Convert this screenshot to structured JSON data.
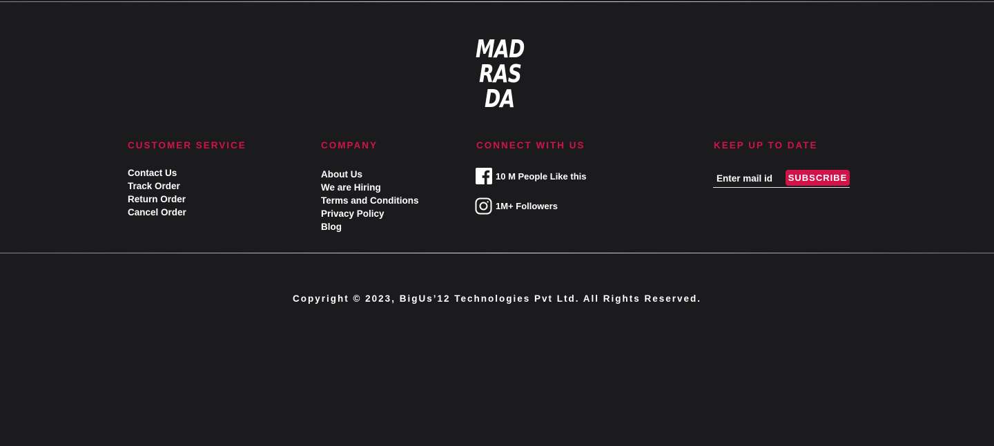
{
  "logo": {
    "lines": [
      "MAD",
      "RAS",
      "DA"
    ]
  },
  "columns": {
    "customer_service": {
      "title": "CUSTOMER SERVICE",
      "links": [
        "Contact Us",
        "Track Order",
        "Return Order",
        "Cancel Order"
      ]
    },
    "company": {
      "title": "COMPANY",
      "links": [
        "About Us",
        "We are Hiring",
        "Terms and Conditions",
        "Privacy Policy",
        "Blog"
      ]
    },
    "connect": {
      "title": "CONNECT WITH US",
      "facebook": {
        "icon": "facebook-icon",
        "text": "10 M People Like this"
      },
      "instagram": {
        "icon": "instagram-icon",
        "text": "1M+ Followers"
      }
    },
    "newsletter": {
      "title": "KEEP UP TO DATE",
      "email_placeholder": "Enter mail id",
      "subscribe_label": "SUBSCRIBE"
    }
  },
  "copyright": "Copyright © 2023, BigUs’12 Technologies Pvt Ltd. All Rights Reserved.",
  "colors": {
    "background": "#1b1b1d",
    "accent": "#d1134a",
    "text": "#ffffff"
  }
}
